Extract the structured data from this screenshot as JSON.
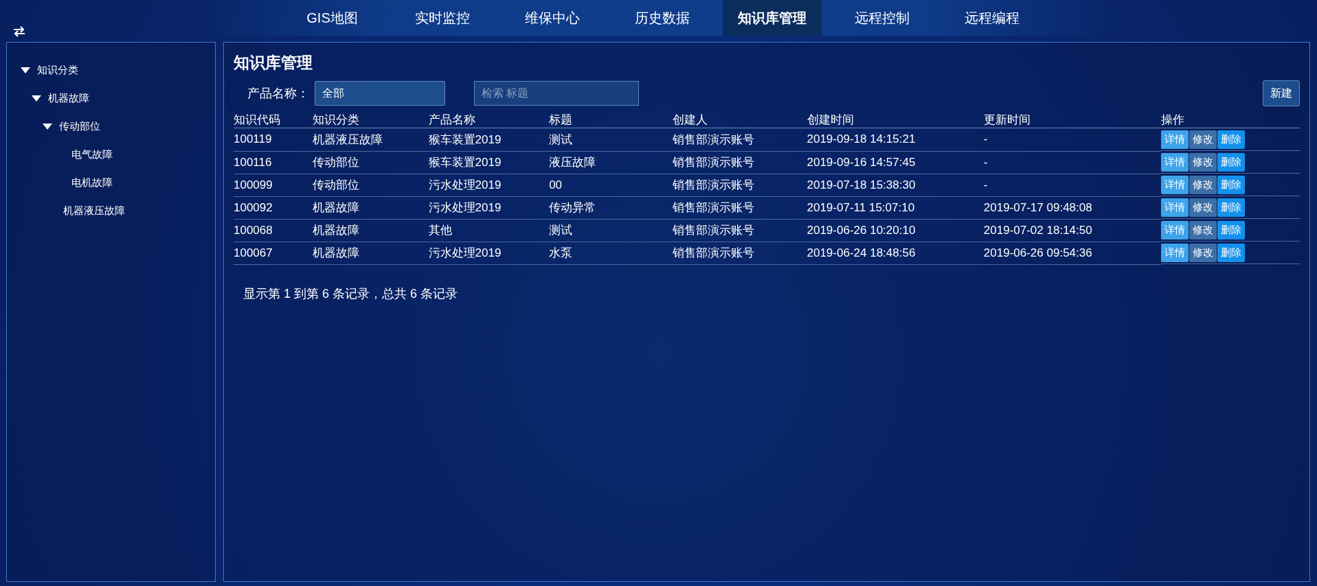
{
  "nav": {
    "tabs": [
      {
        "label": "GIS地图",
        "selected": false
      },
      {
        "label": "实时监控",
        "selected": false
      },
      {
        "label": "维保中心",
        "selected": false
      },
      {
        "label": "历史数据",
        "selected": false
      },
      {
        "label": "知识库管理",
        "selected": true
      },
      {
        "label": "远程控制",
        "selected": false
      },
      {
        "label": "远程编程",
        "selected": false
      }
    ]
  },
  "sidebar": {
    "tree": [
      {
        "label": "知识分类",
        "expanded": true,
        "children": [
          {
            "label": "机器故障",
            "expanded": true,
            "children": [
              {
                "label": "传动部位",
                "expanded": true,
                "children": [
                  {
                    "label": "电气故障"
                  },
                  {
                    "label": "电机故障"
                  }
                ]
              },
              {
                "label": "机器液压故障"
              }
            ]
          }
        ]
      }
    ]
  },
  "main": {
    "title": "知识库管理",
    "filter": {
      "label": "产品名称：",
      "value": "全部"
    },
    "search": {
      "placeholder": "检索 标题"
    },
    "new_button": "新建",
    "table": {
      "columns": [
        "知识代码",
        "知识分类",
        "产品名称",
        "标题",
        "创建人",
        "创建时间",
        "更新时间",
        "操作"
      ],
      "rows": [
        {
          "cells": [
            "100119",
            "机器液压故障",
            "猴车装置2019",
            "测试",
            "销售部演示账号",
            "2019-09-18 14:15:21",
            "-"
          ],
          "actions": [
            {
              "label": "详情",
              "kind": "detail"
            },
            {
              "label": "修改",
              "kind": "edit"
            },
            {
              "label": "删除",
              "kind": "delete"
            }
          ]
        },
        {
          "cells": [
            "100116",
            "传动部位",
            "猴车装置2019",
            "液压故障",
            "销售部演示账号",
            "2019-09-16 14:57:45",
            "-"
          ],
          "actions": [
            {
              "label": "详情",
              "kind": "detail"
            },
            {
              "label": "修改",
              "kind": "edit"
            },
            {
              "label": "删除",
              "kind": "delete"
            }
          ]
        },
        {
          "cells": [
            "100099",
            "传动部位",
            "污水处理2019",
            "00",
            "销售部演示账号",
            "2019-07-18 15:38:30",
            "-"
          ],
          "actions": [
            {
              "label": "详情",
              "kind": "detail"
            },
            {
              "label": "修改",
              "kind": "edit"
            },
            {
              "label": "删除",
              "kind": "delete"
            }
          ]
        },
        {
          "cells": [
            "100092",
            "机器故障",
            "污水处理2019",
            "传动异常",
            "销售部演示账号",
            "2019-07-11 15:07:10",
            "2019-07-17 09:48:08"
          ],
          "actions": [
            {
              "label": "详情",
              "kind": "detail"
            },
            {
              "label": "修改",
              "kind": "edit"
            },
            {
              "label": "删除",
              "kind": "delete"
            }
          ]
        },
        {
          "cells": [
            "100068",
            "机器故障",
            "其他",
            "测试",
            "销售部演示账号",
            "2019-06-26 10:20:10",
            "2019-07-02 18:14:50"
          ],
          "actions": [
            {
              "label": "详情",
              "kind": "detail"
            },
            {
              "label": "修改",
              "kind": "edit"
            },
            {
              "label": "删除",
              "kind": "delete"
            }
          ]
        },
        {
          "cells": [
            "100067",
            "机器故障",
            "污水处理2019",
            "水泵",
            "销售部演示账号",
            "2019-06-24 18:48:56",
            "2019-06-26 09:54:36"
          ],
          "actions": [
            {
              "label": "详情",
              "kind": "detail"
            },
            {
              "label": "修改",
              "kind": "edit"
            },
            {
              "label": "删除",
              "kind": "delete"
            }
          ]
        }
      ]
    },
    "pagination": "显示第 1 到第 6 条记录，总共 6 条记录"
  }
}
